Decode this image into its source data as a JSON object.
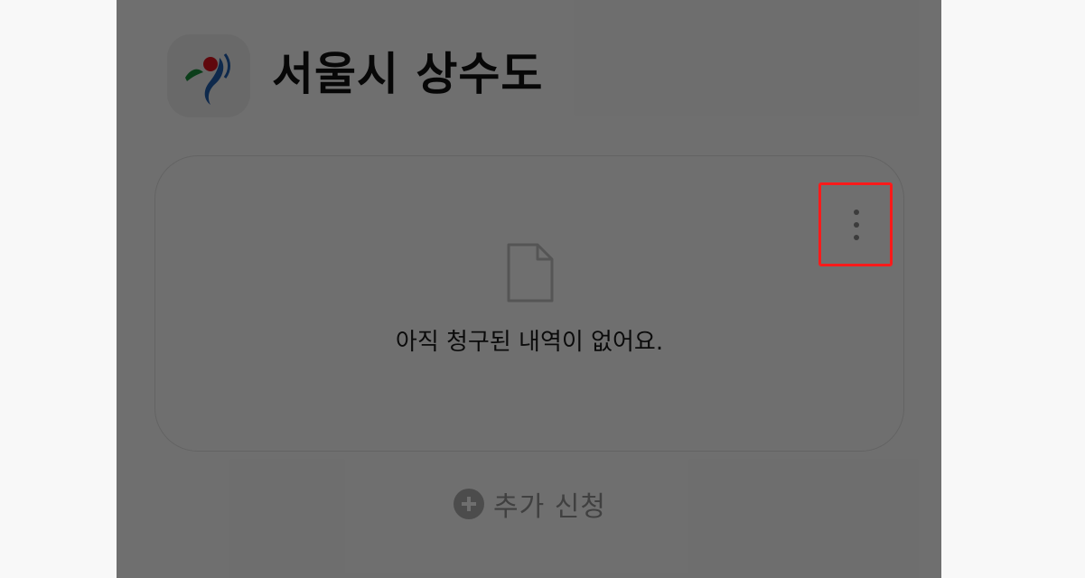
{
  "header": {
    "app_icon": "seoul-city-logo-icon",
    "title": "서울시 상수도"
  },
  "card": {
    "more_icon": "more-vertical-icon",
    "empty_icon": "document-icon",
    "empty_message": "아직 청구된 내역이 없어요."
  },
  "actions": {
    "add_icon": "plus-circle-icon",
    "add_label": "추가 신청"
  },
  "colors": {
    "highlight": "#ff1a1a",
    "logo_red": "#d6131d",
    "logo_green": "#1a8a3a",
    "logo_blue": "#1f5ba8"
  }
}
